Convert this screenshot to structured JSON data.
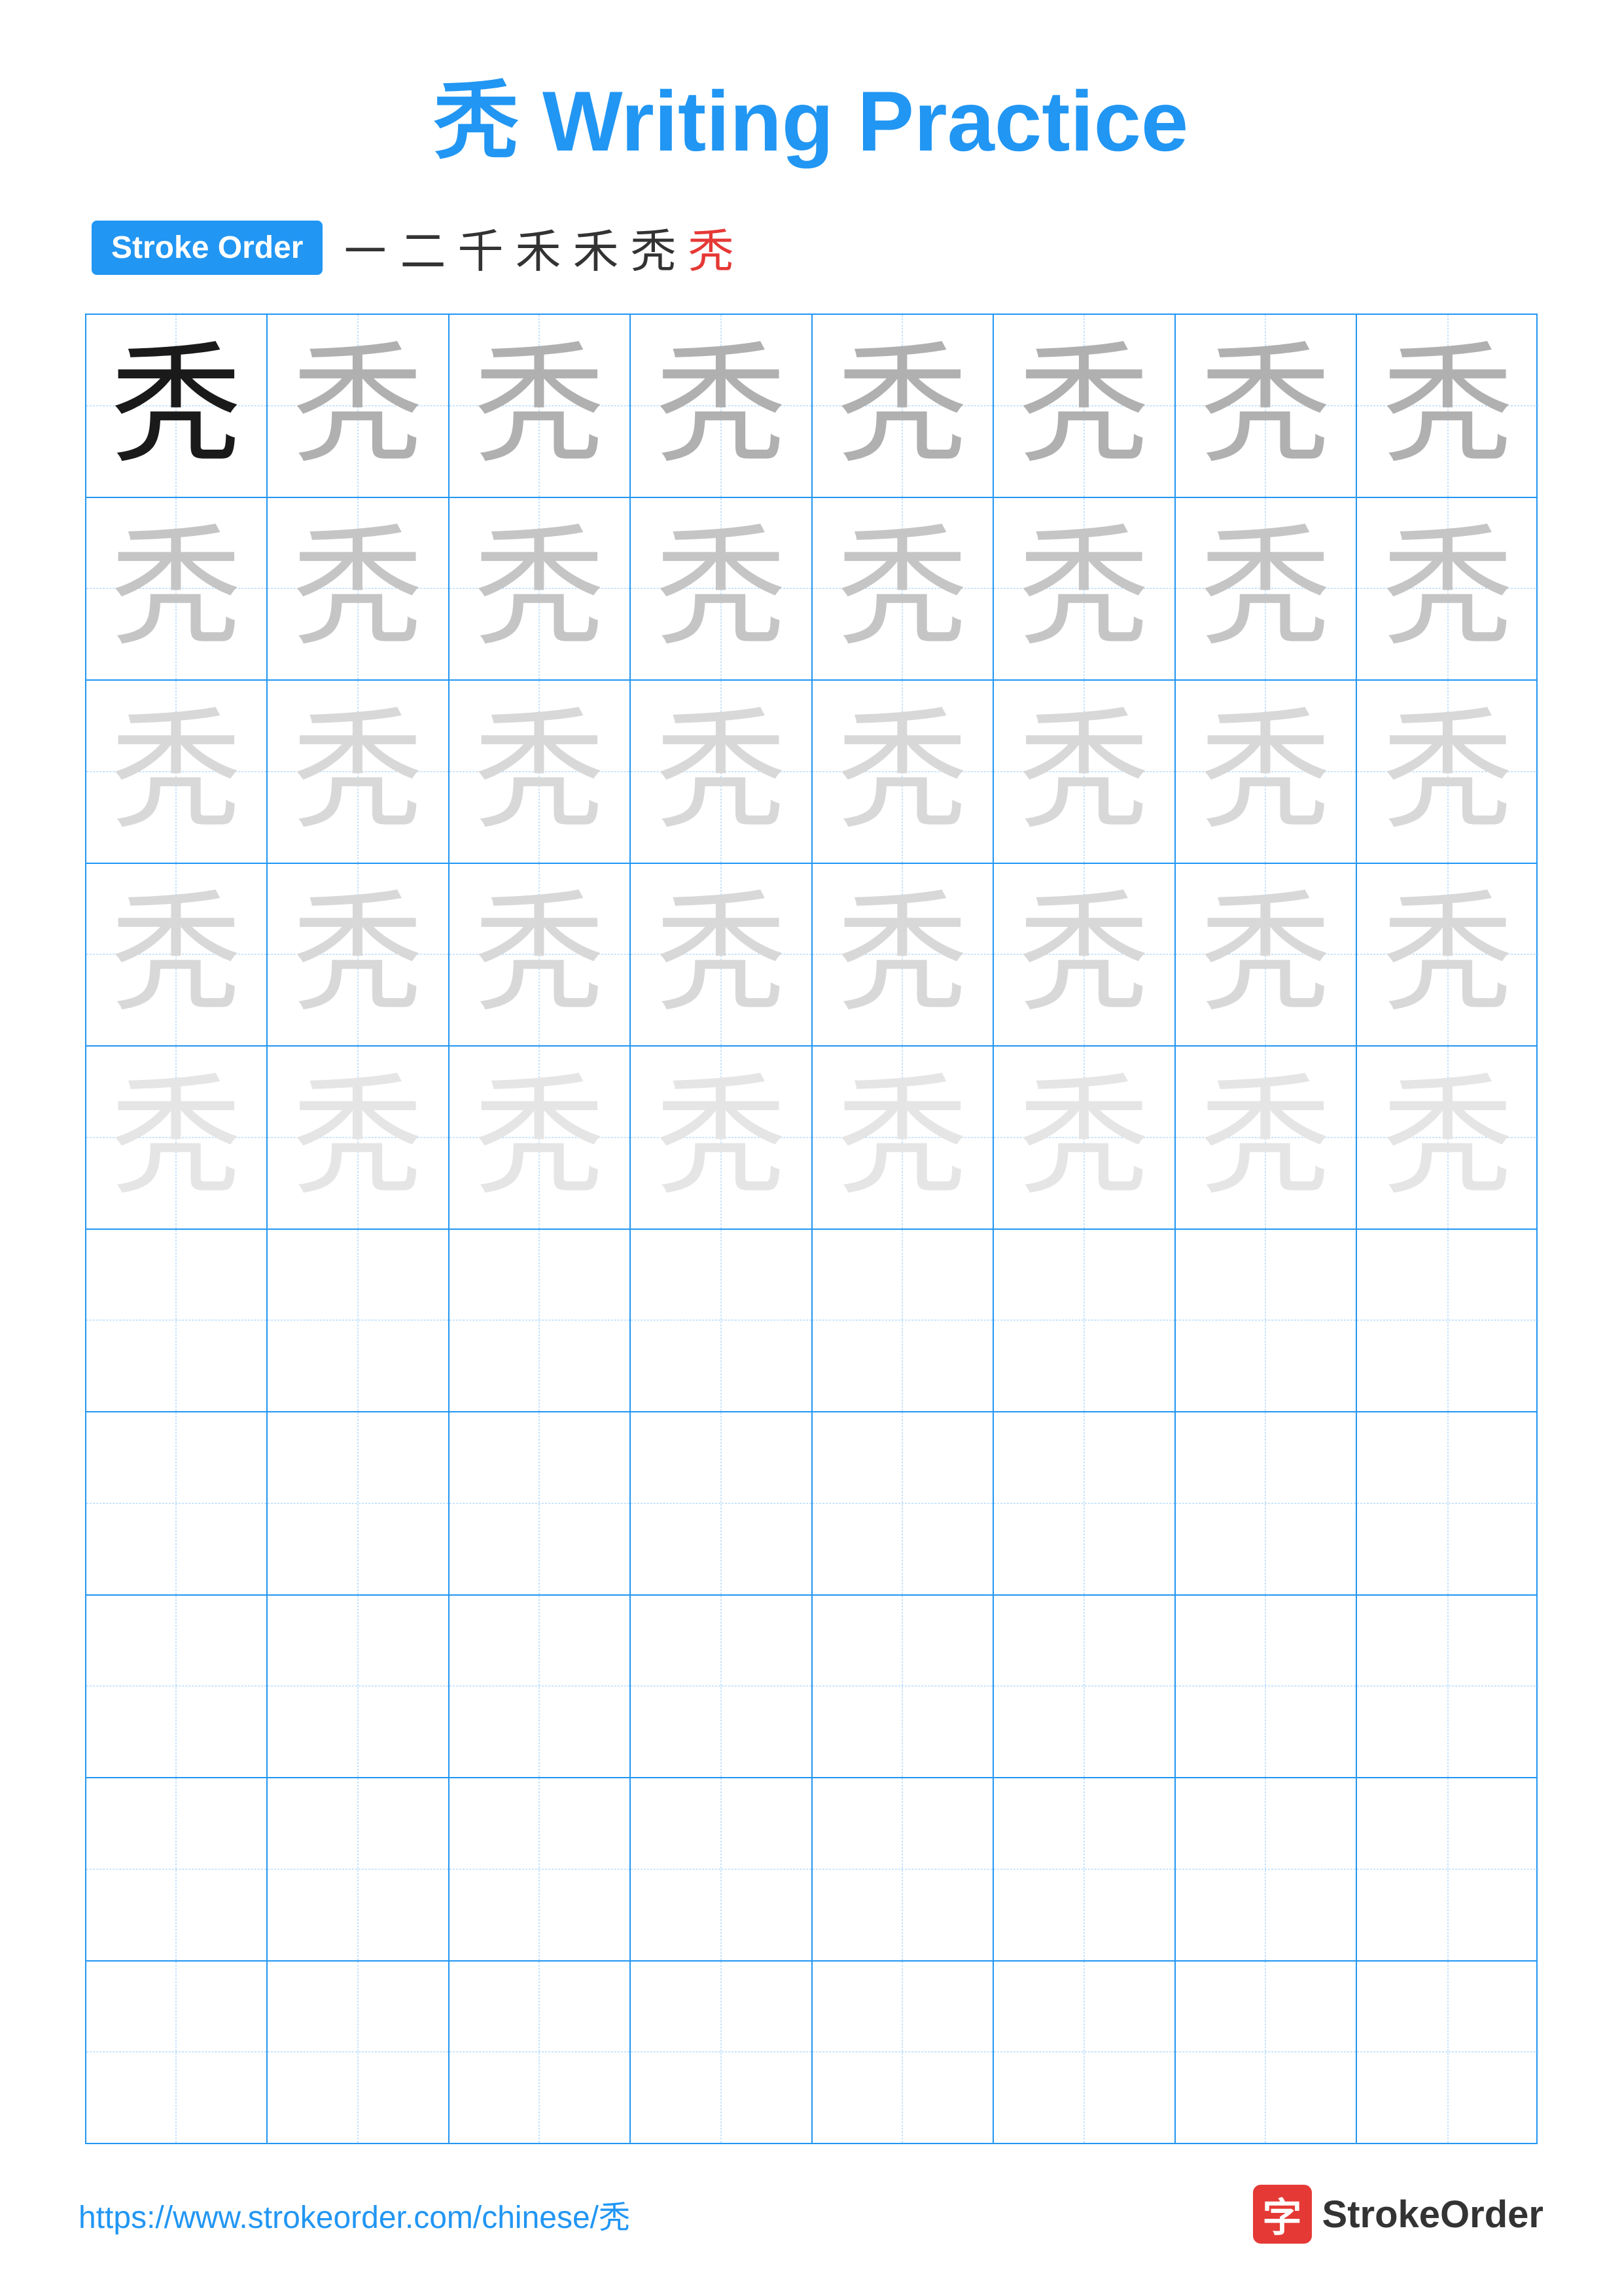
{
  "page": {
    "title": "秃 Writing Practice",
    "stroke_order_label": "Stroke Order",
    "stroke_order_chars": [
      "㇐",
      "二",
      "千",
      "禾",
      "禾",
      "秃",
      "秃"
    ],
    "stroke_order_last_red": true,
    "character": "秃",
    "grid": {
      "rows": 10,
      "cols": 8,
      "practice_rows": 5,
      "gray_shades": [
        "gray1",
        "gray2",
        "gray3",
        "gray4"
      ]
    },
    "footer": {
      "url": "https://www.strokeorder.com/chinese/秃",
      "logo_char": "字",
      "logo_text": "StrokeOrder"
    }
  }
}
